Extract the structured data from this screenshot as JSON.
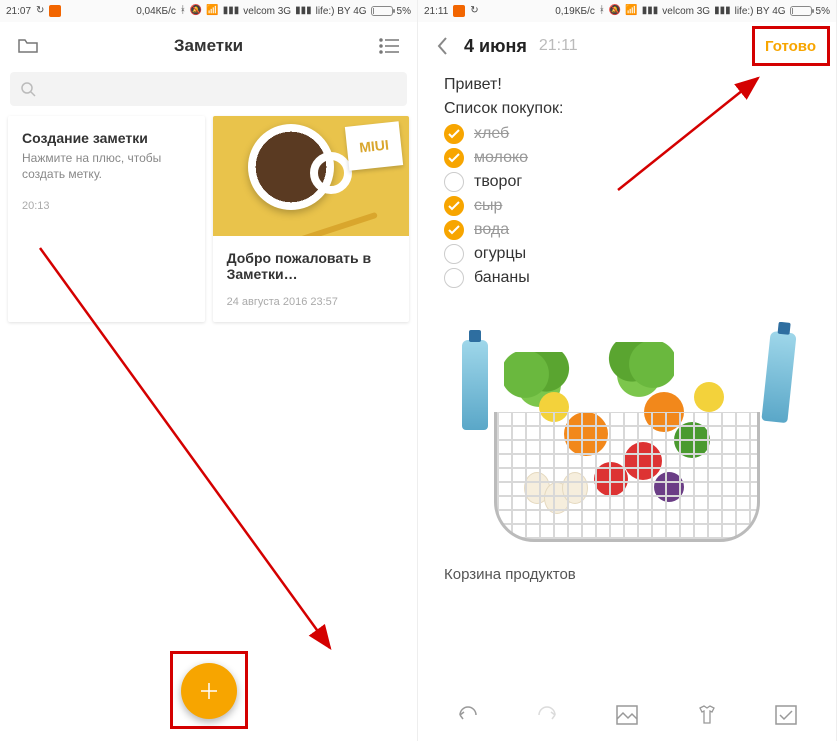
{
  "left": {
    "status": {
      "time": "21:07",
      "traffic": "0,04КБ/с",
      "carrier1": "velcom 3G",
      "carrier2": "life:) BY 4G",
      "battery": "5%"
    },
    "header": {
      "title": "Заметки"
    },
    "cards": [
      {
        "title": "Создание заметки",
        "sub": "Нажмите на плюс, чтобы создать метку.",
        "time": "20:13"
      },
      {
        "title": "Добро пожаловать в Заметки…",
        "time": "24 августа 2016 23:57",
        "miui": "MIUI"
      }
    ]
  },
  "right": {
    "status": {
      "time": "21:11",
      "traffic": "0,19КБ/с",
      "carrier1": "velcom 3G",
      "carrier2": "life:) BY 4G",
      "battery": "5%"
    },
    "header": {
      "date": "4 июня",
      "time": "21:11",
      "done": "Готово"
    },
    "body": {
      "greeting": "Привет!",
      "listTitle": "Список покупок:",
      "items": [
        {
          "label": "хлеб",
          "checked": true
        },
        {
          "label": "молоко",
          "checked": true
        },
        {
          "label": "творог",
          "checked": false
        },
        {
          "label": "сыр",
          "checked": true
        },
        {
          "label": "вода",
          "checked": true
        },
        {
          "label": "огурцы",
          "checked": false
        },
        {
          "label": "бананы",
          "checked": false
        }
      ],
      "caption": "Корзина продуктов"
    }
  }
}
